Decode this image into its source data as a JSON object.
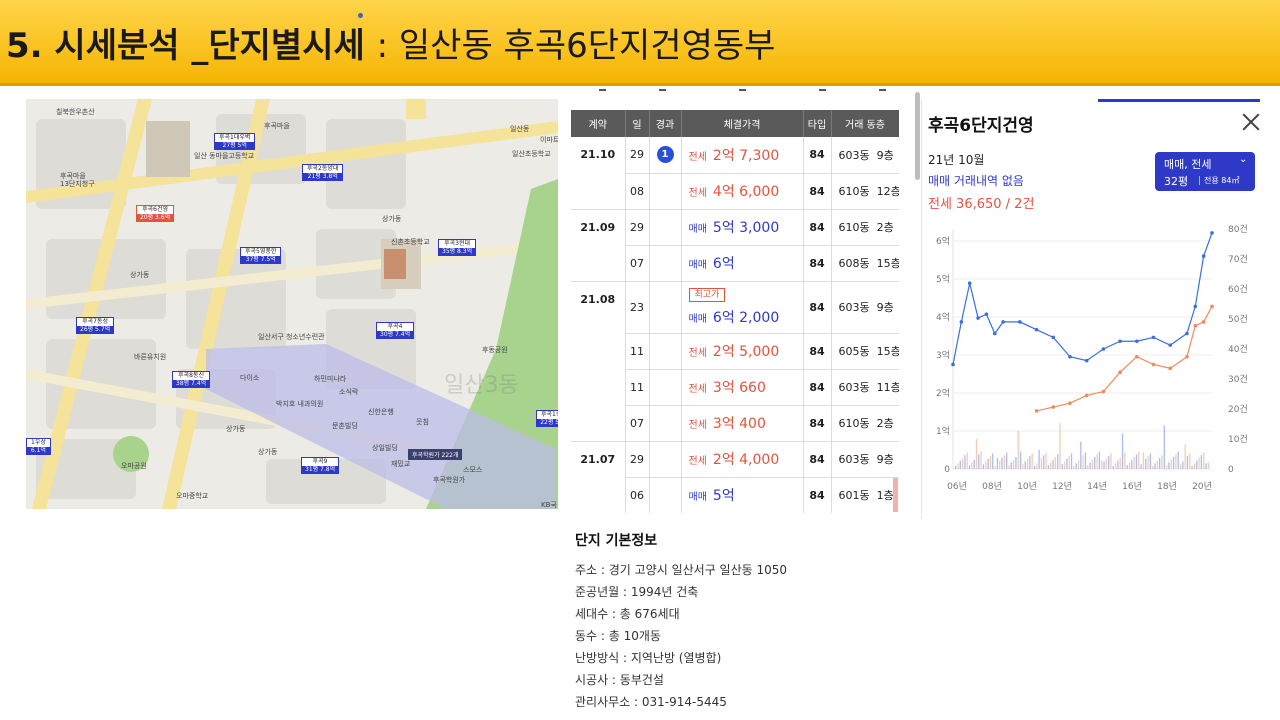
{
  "header": {
    "title_main": "5. 시세분석 _단지별시세",
    "title_sub": ": 일산동 후곡6단지건영동부"
  },
  "map": {
    "labels": {
      "l1": "칠북한우촌산",
      "l2": "일산동",
      "l3": "후곡마을",
      "l4": "13단지청구",
      "l5": "후곡마을",
      "l6": "일산 동마을고등학교",
      "l7": "일산초등학교",
      "l8": "이마트",
      "l9": "상가동",
      "l10": "신촌초등학교",
      "l11": "상가동",
      "l12": "일산서구 청소년수련관",
      "l13": "후동공원",
      "l14": "다이소",
      "l15": "하민미나라",
      "l16": "소식락",
      "l17": "신한은행",
      "l18": "박지호 내과의원",
      "l19": "문촌빌딩",
      "l20": "웃침",
      "l21": "상일빌딩",
      "l22": "재밌교",
      "l23": "스모스",
      "l24": "후곡학원가",
      "l25": "오마공원",
      "l26": "오마중학교",
      "l27": "상가동",
      "l28": "바른유치원",
      "l29": "상가동",
      "l30": "KB국"
    },
    "watermark": "일산3동",
    "pins": [
      {
        "name": "후곡1대우벽",
        "val": "27평 5억"
      },
      {
        "name": "후곡2동양대",
        "val": "21평 3.8억"
      },
      {
        "name": "후곡6건영",
        "val": "20평 3.6억"
      },
      {
        "name": "후곡5영풍한",
        "val": "37평 7.5억"
      },
      {
        "name": "후곡3현대",
        "val": "35평 8.3억"
      },
      {
        "name": "후곡7동성",
        "val": "26평 5.7억"
      },
      {
        "name": "후곡4",
        "val": "30평 7.4억"
      },
      {
        "name": "후곡8동신",
        "val": "38평 7.4억"
      },
      {
        "name": "후곡9",
        "val": "31평 7.8억"
      },
      {
        "name": "1우성",
        "val": "6.1억"
      },
      {
        "name": "후곡1!",
        "val": "22평 5"
      }
    ],
    "academy": "후곡학원가 222개"
  },
  "transactions": {
    "headers": [
      "계약",
      "일",
      "경과",
      "체결가격",
      "타입",
      "거래 동층"
    ],
    "rows": [
      {
        "date": "21.10",
        "day": "29",
        "pass": "1",
        "high": "",
        "kind": "전세",
        "amount": "2억 7,300",
        "type": "84",
        "dong": "603동",
        "floor": "9층"
      },
      {
        "date": "",
        "day": "08",
        "pass": "",
        "high": "",
        "kind": "전세",
        "amount": "4억 6,000",
        "type": "84",
        "dong": "610동",
        "floor": "12층"
      },
      {
        "date": "21.09",
        "day": "29",
        "pass": "",
        "high": "",
        "kind": "매매",
        "amount": "5억 3,000",
        "type": "84",
        "dong": "610동",
        "floor": "2층"
      },
      {
        "date": "",
        "day": "07",
        "pass": "",
        "high": "",
        "kind": "매매",
        "amount": "6억",
        "type": "84",
        "dong": "608동",
        "floor": "15층"
      },
      {
        "date": "21.08",
        "day": "23",
        "pass": "",
        "high": "최고가",
        "kind": "매매",
        "amount": "6억 2,000",
        "type": "84",
        "dong": "603동",
        "floor": "9층"
      },
      {
        "date": "",
        "day": "11",
        "pass": "",
        "high": "",
        "kind": "전세",
        "amount": "2억 5,000",
        "type": "84",
        "dong": "605동",
        "floor": "15층"
      },
      {
        "date": "",
        "day": "11",
        "pass": "",
        "high": "",
        "kind": "전세",
        "amount": "3억 660",
        "type": "84",
        "dong": "603동",
        "floor": "11층"
      },
      {
        "date": "",
        "day": "07",
        "pass": "",
        "high": "",
        "kind": "전세",
        "amount": "3억 400",
        "type": "84",
        "dong": "610동",
        "floor": "2층"
      },
      {
        "date": "21.07",
        "day": "29",
        "pass": "",
        "high": "",
        "kind": "전세",
        "amount": "2억 4,000",
        "type": "84",
        "dong": "603동",
        "floor": "9층"
      },
      {
        "date": "",
        "day": "06",
        "pass": "",
        "high": "",
        "kind": "매매",
        "amount": "5억",
        "type": "84",
        "dong": "601동",
        "floor": "1층"
      }
    ]
  },
  "info": {
    "title": "단지 기본정보",
    "rows": [
      "주소 : 경기 고양시 일산서구 일산동 1050",
      "준공년월 : 1994년 건축",
      "세대수 : 총 676세대",
      "동수 : 총 10개동",
      "난방방식 : 지역난방 (열병합)",
      "시공사 : 동부건설",
      "관리사무소 : 031-914-5445"
    ]
  },
  "panel": {
    "title": "후곡6단지건영",
    "month": "21년 10월",
    "no_deal": "매매 거래내역 없음",
    "jeonse": "전세 36,650 / 2건",
    "filter_type": "매매, 전세",
    "filter_size": "32평",
    "filter_area": "전용 84㎡",
    "colors": {
      "sale": "#3a6fe0",
      "rent": "#f08a5d",
      "accent": "#2f39c8"
    }
  },
  "chart_data": {
    "type": "line",
    "x_ticks": [
      "06년",
      "08년",
      "10년",
      "12년",
      "14년",
      "16년",
      "18년",
      "20년"
    ],
    "y_left_ticks": [
      "0",
      "1억",
      "2억",
      "3억",
      "4억",
      "5억",
      "6억"
    ],
    "y_right_ticks": [
      "0",
      "10건",
      "20건",
      "30건",
      "40건",
      "50건",
      "60건",
      "70건",
      "80건"
    ],
    "x": [
      2006,
      2006.5,
      2007,
      2007.5,
      2008,
      2008.5,
      2009,
      2010,
      2011,
      2012,
      2013,
      2014,
      2015,
      2016,
      2017,
      2018,
      2019,
      2020,
      2020.5,
      2021,
      2021.5
    ],
    "series": [
      {
        "name": "매매",
        "values": [
          2.7,
          3.8,
          4.8,
          3.9,
          4.0,
          3.5,
          3.8,
          3.8,
          3.6,
          3.4,
          2.9,
          2.8,
          3.1,
          3.3,
          3.3,
          3.4,
          3.2,
          3.5,
          4.2,
          5.5,
          6.1
        ]
      },
      {
        "name": "전세",
        "values": [
          null,
          null,
          null,
          null,
          null,
          null,
          null,
          null,
          1.5,
          1.6,
          1.7,
          1.9,
          2.0,
          2.5,
          2.9,
          2.7,
          2.6,
          2.9,
          3.7,
          3.8,
          4.2
        ]
      }
    ],
    "ylim": [
      0,
      6.2
    ],
    "y2lim": [
      0,
      80
    ]
  }
}
